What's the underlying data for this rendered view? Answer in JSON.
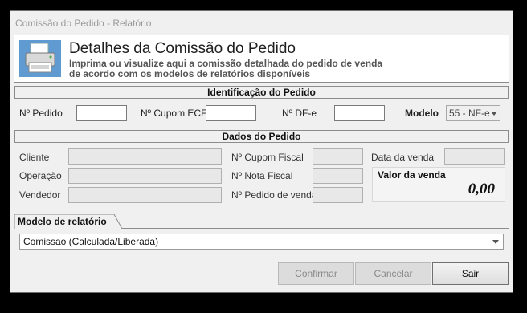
{
  "window": {
    "title": "Comissão do Pedido - Relatório"
  },
  "header": {
    "title": "Detalhes da Comissão do Pedido",
    "subtitle_line1": "Imprima ou visualize aqui a comissão detalhada do pedido de venda",
    "subtitle_line2": "de acordo com os modelos de relatórios  disponíveis",
    "icon": "printer-icon"
  },
  "identificacao": {
    "heading": "Identificação do Pedido",
    "pedido_label": "Nº Pedido",
    "pedido_value": "",
    "cupom_label": "Nº Cupom ECF",
    "cupom_value": "",
    "dfe_label": "Nº DF-e",
    "dfe_value": "",
    "modelo_label": "Modelo",
    "modelo_value": "55 - NF-e"
  },
  "dados": {
    "heading": "Dados do Pedido",
    "cliente_label": "Cliente",
    "operacao_label": "Operação",
    "vendedor_label": "Vendedor",
    "cupom_fiscal_label": "Nº Cupom Fiscal",
    "nota_fiscal_label": "Nº Nota Fiscal",
    "pedido_venda_label": "Nº Pedido de venda",
    "data_venda_label": "Data da venda",
    "valor_venda_label": "Valor da venda",
    "valor_venda_value": "0,00"
  },
  "modelo_relatorio": {
    "tab_label": "Modelo de relatório",
    "selected": "Comissao (Calculada/Liberada)"
  },
  "buttons": {
    "confirmar": "Confirmar",
    "cancelar": "Cancelar",
    "sair": "Sair"
  }
}
